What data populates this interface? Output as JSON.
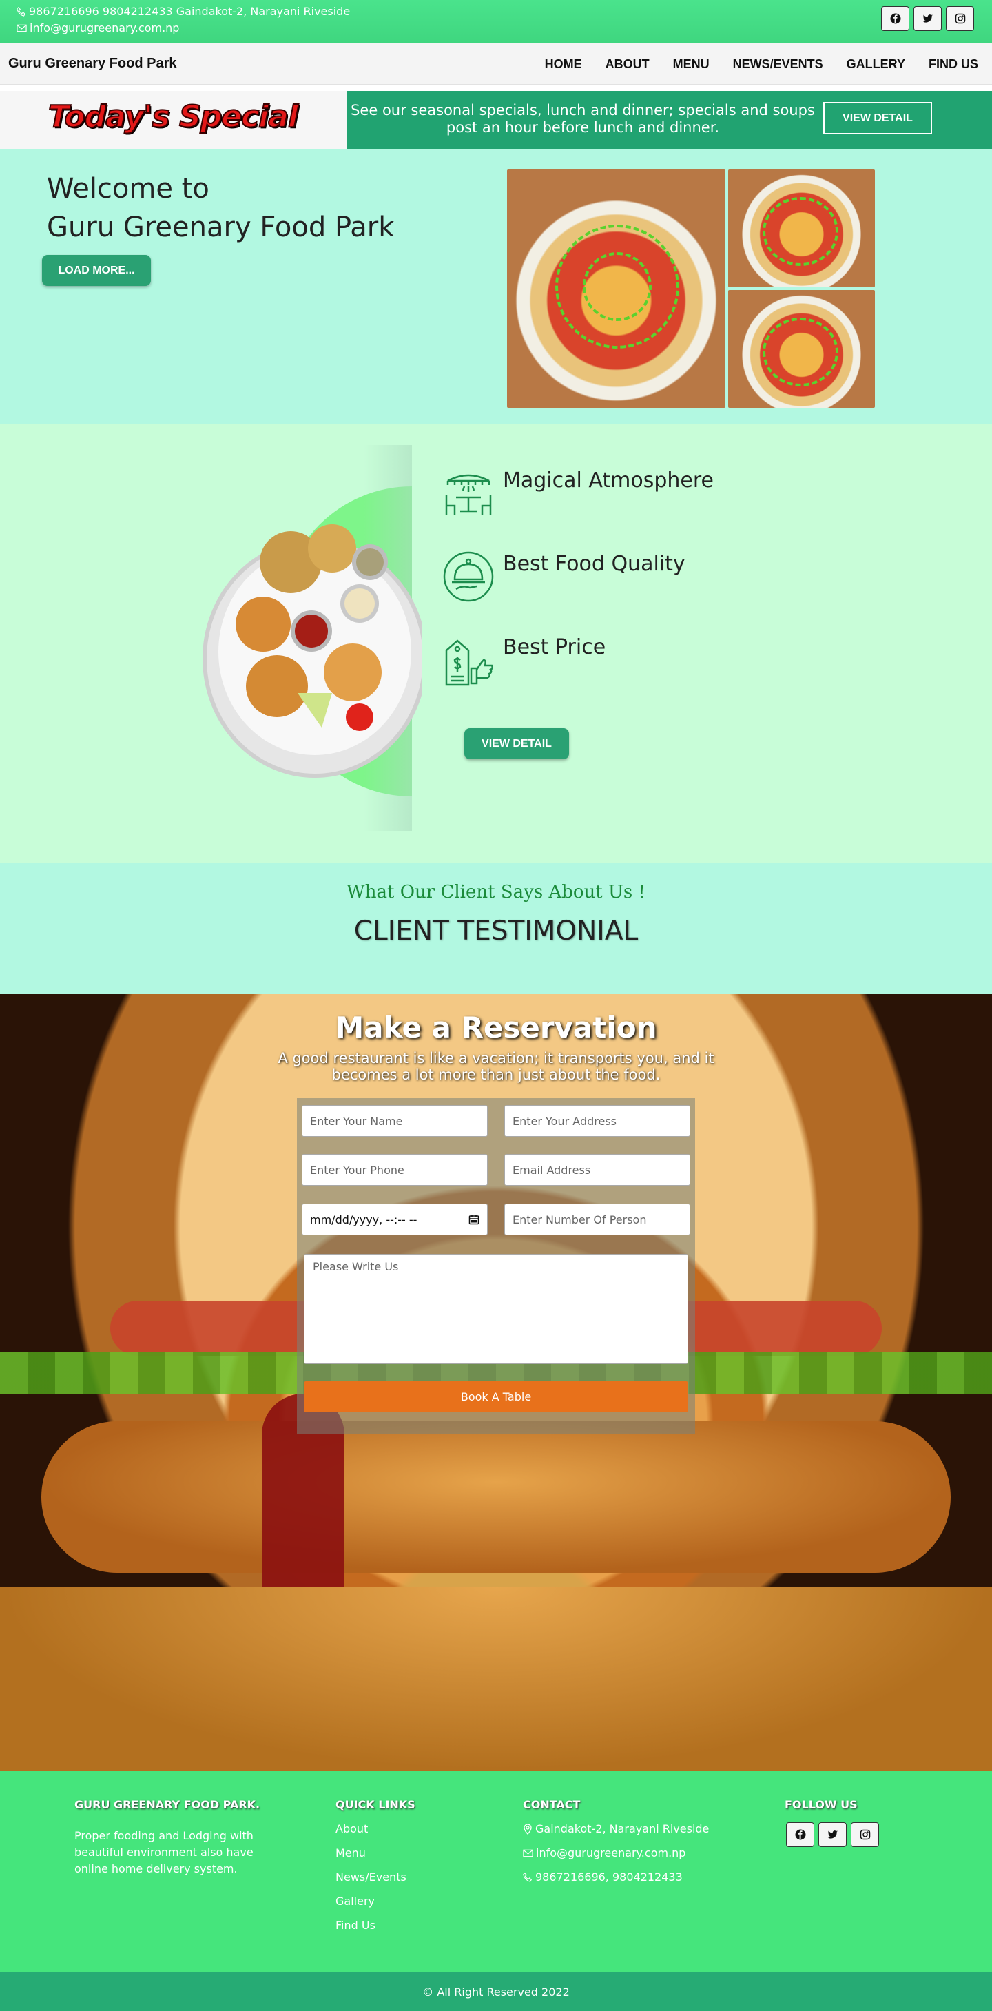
{
  "topbar": {
    "phone_address": "9867216696 9804212433 Gaindakot-2, Narayani Riveside",
    "email": "info@gurugreenary.com.np",
    "socials": [
      "facebook-icon",
      "twitter-icon",
      "instagram-icon"
    ]
  },
  "navbar": {
    "brand": "Guru Greenary Food Park",
    "items": [
      "HOME",
      "ABOUT",
      "MENU",
      "NEWS/EVENTS",
      "GALLERY",
      "FIND US"
    ]
  },
  "special": {
    "title": "Today's Special",
    "message": "See our seasonal specials, lunch and dinner; specials and soups post an hour before lunch and dinner.",
    "button": "VIEW DETAIL"
  },
  "hero": {
    "line1": "Welcome to",
    "line2": "Guru Greenary Food Park",
    "button": "LOAD MORE..."
  },
  "features": {
    "items": [
      {
        "title": "Magical Atmosphere",
        "icon": "restaurant-table-icon"
      },
      {
        "title": "Best Food Quality",
        "icon": "cloche-icon"
      },
      {
        "title": "Best Price",
        "icon": "price-tag-icon"
      }
    ],
    "button": "VIEW DETAIL"
  },
  "testimonial": {
    "subtitle": "What Our Client Says About Us !",
    "title": "CLIENT TESTIMONIAL"
  },
  "reservation": {
    "title": "Make a Reservation",
    "lead": "A good restaurant is like a vacation; it transports you, and it becomes a lot more than just about the food.",
    "name_placeholder": "Enter Your Name",
    "address_placeholder": "Enter Your Address",
    "phone_placeholder": "Enter Your Phone",
    "email_placeholder": "Email Address",
    "datetime_value": "mm/dd/yyyy, --:-- --",
    "persons_placeholder": "Enter Number Of Person",
    "message_placeholder": "Please Write Us",
    "submit": "Book A Table"
  },
  "footer": {
    "about_title": "GURU GREENARY FOOD PARK.",
    "about_text": "Proper fooding and Lodging with beautiful environment also have online home delivery system.",
    "links_title": "QUICK LINKS",
    "links": [
      "About",
      "Menu",
      "News/Events",
      "Gallery",
      "Find Us"
    ],
    "contact_title": "CONTACT",
    "address": "Gaindakot-2, Narayani Riveside",
    "email": "info@gurugreenary.com.np",
    "phone": "9867216696, 9804212433",
    "follow_title": "FOLLOW US",
    "copyright": "© All Right Reserved 2022"
  },
  "colors": {
    "primary_green": "#45e57c",
    "dark_green": "#2aa173",
    "mint": "#b2f8e1",
    "light_green": "#c8fdd8",
    "orange": "#e8711b"
  }
}
